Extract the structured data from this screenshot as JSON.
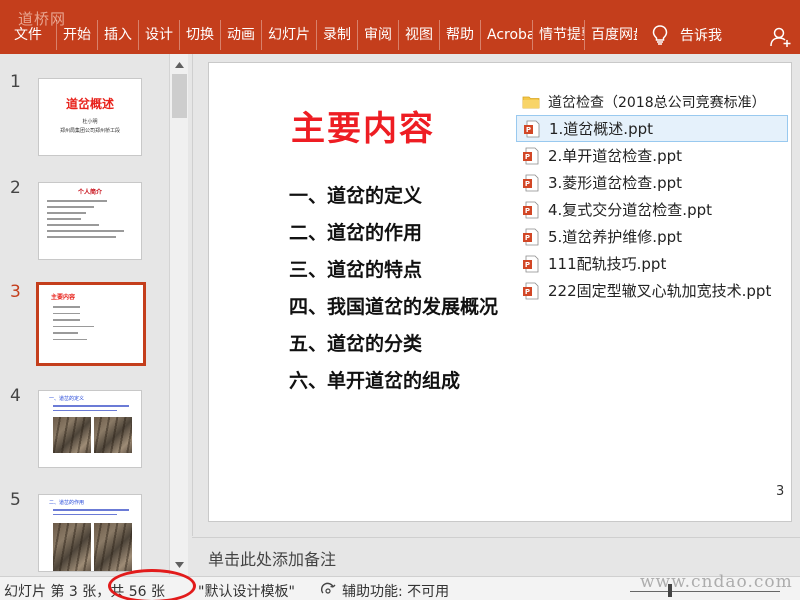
{
  "watermarks": {
    "top": "道桥网",
    "bottom": "www.cndao.com"
  },
  "ribbon": {
    "tabs": [
      "文件",
      "开始",
      "插入",
      "设计",
      "切换",
      "动画",
      "幻灯片",
      "录制",
      "审阅",
      "视图",
      "帮助",
      "Acrobat",
      "情节提要",
      "百度网盘"
    ],
    "tell_me": "告诉我",
    "colors": {
      "accent": "#c43e1c"
    }
  },
  "thumbnails": {
    "numbers": [
      "1",
      "2",
      "3",
      "4",
      "5"
    ],
    "active": "3",
    "slide1": {
      "title": "道岔概述",
      "line1": "杜小明",
      "line2": "郑州局集团公司郑州桥工段"
    },
    "slide2": {
      "title": "个人简介"
    },
    "slide3": {
      "title": "主要内容"
    },
    "slide4": {
      "title": "一、道岔的定义"
    },
    "slide5": {
      "title": "二、道岔的作用"
    }
  },
  "slide": {
    "title": "主要内容",
    "items": [
      "一、道岔的定义",
      "二、道岔的作用",
      "三、道岔的特点",
      "四、我国道岔的发展概况",
      "五、道岔的分类",
      "六、单开道岔的组成"
    ],
    "number": "3"
  },
  "file_list": {
    "folder": "道岔检查（2018总公司竞赛标准）",
    "files": [
      "1.道岔概述.ppt",
      "2.单开道岔检查.ppt",
      "3.菱形道岔检查.ppt",
      "4.复式交分道岔检查.ppt",
      "5.道岔养护维修.ppt",
      "111配轨技巧.ppt",
      "222固定型辙叉心轨加宽技术.ppt"
    ],
    "selected_index": 0
  },
  "notes": {
    "placeholder": "单击此处添加备注"
  },
  "status": {
    "slide_info": "幻灯片 第 3 张，共 56 张",
    "template": "\"默认设计模板\"",
    "accessibility": "辅助功能: 不可用"
  }
}
